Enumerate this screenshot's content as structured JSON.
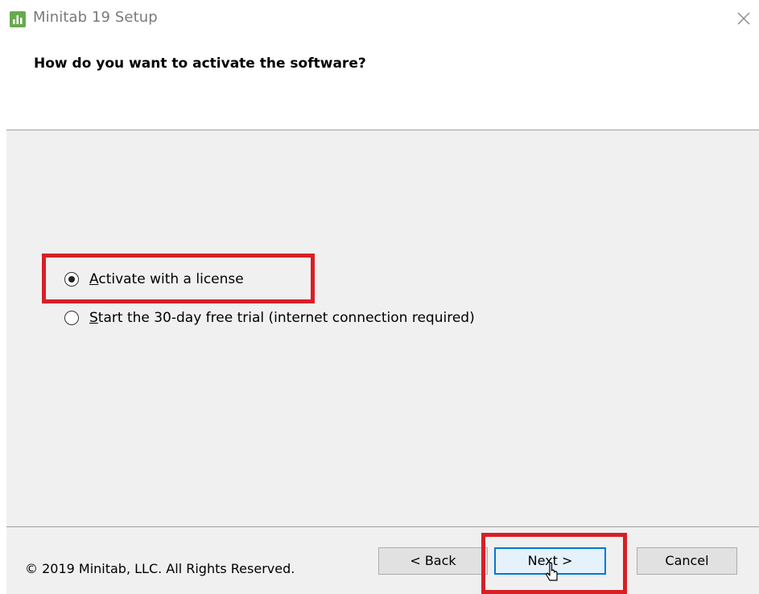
{
  "window": {
    "title": "Minitab 19 Setup",
    "app_icon": "minitab-bar-chart-icon",
    "close_icon": "close-icon"
  },
  "header": {
    "question": "How do you want to activate the software?"
  },
  "options": [
    {
      "mnemonic": "A",
      "rest": "ctivate with a license",
      "selected": true
    },
    {
      "mnemonic": "S",
      "rest": "tart the 30-day free trial (internet connection required)",
      "selected": false
    }
  ],
  "footer": {
    "copyright": "© 2019 Minitab, LLC. All Rights Reserved.",
    "back_label": "< Back",
    "next_label": "Next >",
    "cancel_label": "Cancel"
  },
  "colors": {
    "highlight": "#d81f26",
    "default_button_border": "#0078d7",
    "content_background": "#f0f0f0",
    "app_icon_green": "#6aa84f"
  }
}
